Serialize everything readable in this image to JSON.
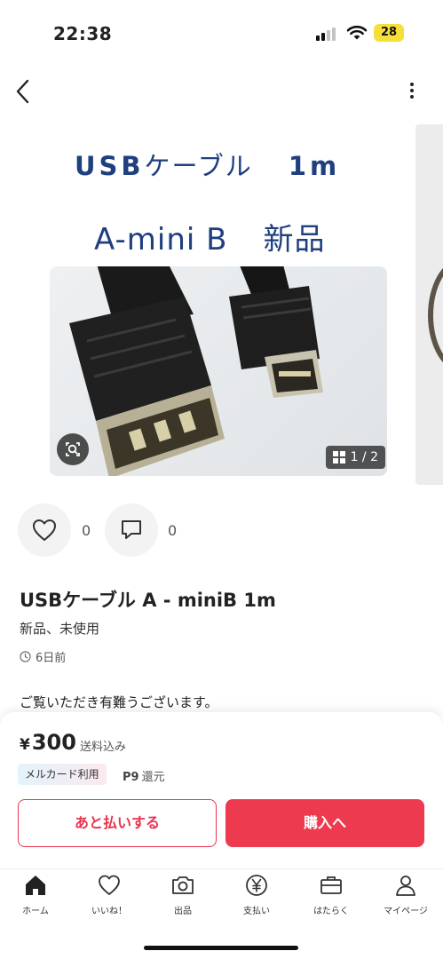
{
  "status_bar": {
    "time": "22:38",
    "battery": "28"
  },
  "gallery": {
    "image_text": {
      "line1_product": "USB",
      "line1_word": "ケーブル",
      "line1_size": "1m",
      "line2_model": "A-mini B",
      "line2_status": "新品"
    },
    "counter": "1 / 2"
  },
  "actions": {
    "likes": "0",
    "comments": "0"
  },
  "item": {
    "title": "USBケーブル A - miniB 1m",
    "condition": "新品、未使用",
    "posted": "6日前",
    "description": "ご覧いただき有難うございます。"
  },
  "purchase": {
    "currency": "¥",
    "price": "300",
    "shipping": "送料込み",
    "card_badge": "メルカード利用",
    "points_value": "P9",
    "points_label": "還元",
    "pay_later_label": "あと払いする",
    "buy_label": "購入へ"
  },
  "tabs": [
    {
      "label": "ホーム",
      "icon": "home-icon"
    },
    {
      "label": "いいね！",
      "icon": "heart-icon"
    },
    {
      "label": "出品",
      "icon": "camera-icon"
    },
    {
      "label": "支払い",
      "icon": "yen-icon"
    },
    {
      "label": "はたらく",
      "icon": "briefcase-icon"
    },
    {
      "label": "マイページ",
      "icon": "person-icon"
    }
  ],
  "colors": {
    "accent": "#ee3a4f",
    "image_text": "#1f3f7e"
  }
}
